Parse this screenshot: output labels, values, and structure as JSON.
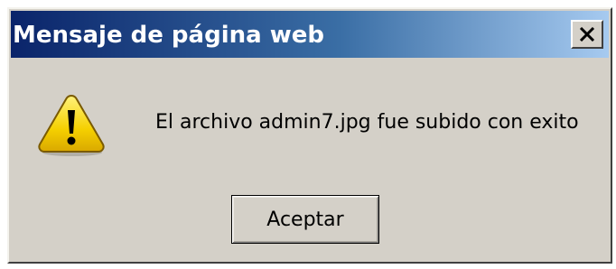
{
  "dialog": {
    "title": "Mensaje de página web",
    "close_icon": "close-icon",
    "message_icon": "warning-icon",
    "message": "El archivo admin7.jpg fue subido con exito",
    "ok_label": "Aceptar"
  },
  "colors": {
    "titlebar_start": "#0a246a",
    "titlebar_end": "#a6caf0",
    "face": "#d4d0c8",
    "warning_fill": "#f5d000"
  }
}
